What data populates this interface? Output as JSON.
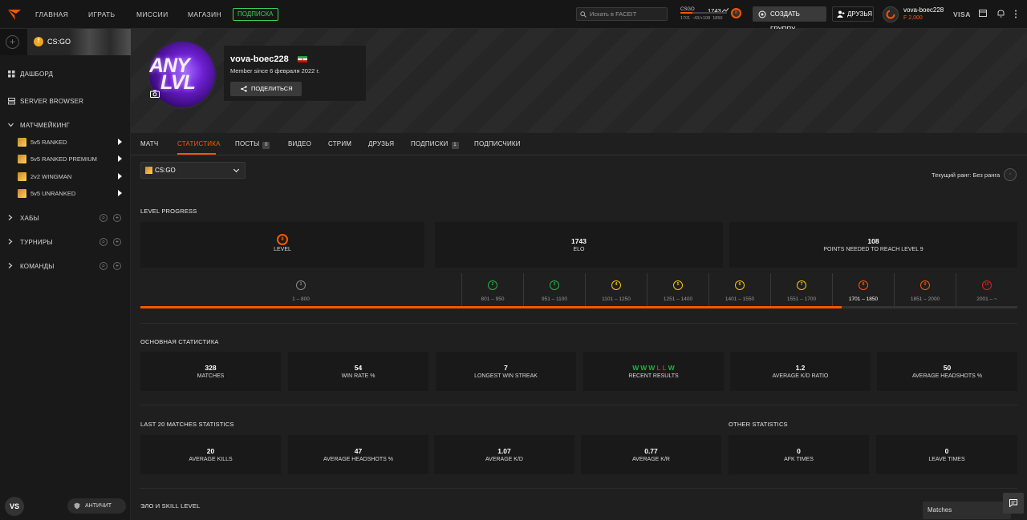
{
  "topbar": {
    "nav": [
      "ГЛАВНАЯ",
      "ИГРАТЬ",
      "МИССИИ",
      "МАГАЗИН"
    ],
    "subscribe_label": "ПОДПИСКА",
    "search_placeholder": "Искать в FACEIT",
    "elo_game": "CSGO",
    "elo_value": "1743",
    "elo_detail": "1701  -43/+108  1850",
    "elo_level": "8",
    "create_group_label": "СОЗДАТЬ ГРУППУ",
    "friends_label": "ДРУЗЬЯ",
    "user_name": "vova-boec228",
    "user_points": "2,000",
    "visa_label": "VISA"
  },
  "sidebar": {
    "game_label": "CS:GO",
    "dashboard": "ДАШБОРД",
    "server_browser": "SERVER BROWSER",
    "matchmaking": "МАТЧМЕЙКИНГ",
    "queues": [
      "5v5 RANKED",
      "5v5 RANKED PREMIUM",
      "2v2 WINGMAN",
      "5v5 UNRANKED"
    ],
    "hubs": "ХАБЫ",
    "tournaments": "ТУРНИРЫ",
    "teams": "КОМАНДЫ",
    "vs_label": "VS",
    "anticheat_label": "АНТИЧИТ"
  },
  "profile": {
    "avatar_text_line1": "ANY",
    "avatar_text_line2": "LVL",
    "username": "vova-boec228",
    "member_since": "Member since 6 февраля 2022 г.",
    "share_label": "ПОДЕЛИТЬСЯ"
  },
  "tabs": [
    {
      "label": "МАТЧ",
      "badge": ""
    },
    {
      "label": "СТАТИСТИКА",
      "badge": ""
    },
    {
      "label": "ПОСТЫ",
      "badge": "0"
    },
    {
      "label": "ВИДЕО",
      "badge": ""
    },
    {
      "label": "СТРИМ",
      "badge": ""
    },
    {
      "label": "ДРУЗЬЯ",
      "badge": ""
    },
    {
      "label": "ПОДПИСКИ",
      "badge": "1"
    },
    {
      "label": "ПОДПИСЧИКИ",
      "badge": ""
    }
  ],
  "main": {
    "game_select": "CS:GO",
    "current_rank": "Текущий ранг: Без ранга",
    "level_progress_title": "LEVEL PROGRESS",
    "level_card": {
      "value": "8",
      "label": "LEVEL"
    },
    "elo_card": {
      "value": "1743",
      "label": "ELO"
    },
    "points_card": {
      "value": "108",
      "label": "POINTS NEEDED TO REACH LEVEL 9"
    },
    "level_ranges": [
      {
        "level": "1",
        "range": "1 – 800",
        "color": "#8a8a8a"
      },
      {
        "level": "2",
        "range": "801 – 950",
        "color": "#1fb33f"
      },
      {
        "level": "3",
        "range": "951 – 1100",
        "color": "#1fb33f"
      },
      {
        "level": "4",
        "range": "1101 – 1250",
        "color": "#f5c800"
      },
      {
        "level": "5",
        "range": "1251 – 1400",
        "color": "#f5c800"
      },
      {
        "level": "6",
        "range": "1401 – 1550",
        "color": "#f5c800"
      },
      {
        "level": "7",
        "range": "1551 – 1700",
        "color": "#f5c800"
      },
      {
        "level": "8",
        "range": "1701 – 1850",
        "color": "#ff5500"
      },
      {
        "level": "9",
        "range": "1851 – 2000",
        "color": "#ff5500"
      },
      {
        "level": "10",
        "range": "2001 – ~",
        "color": "#e01d1d"
      }
    ],
    "progress_fraction": 0.8,
    "main_stats_title": "ОСНОВНАЯ СТАТИСТИКА",
    "main_stats": [
      {
        "value": "328",
        "label": "MATCHES"
      },
      {
        "value": "54",
        "label": "WIN RATE %"
      },
      {
        "value": "7",
        "label": "LONGEST WIN STREAK"
      },
      {
        "value": "",
        "label": "RECENT RESULTS"
      },
      {
        "value": "1.2",
        "label": "AVERAGE K/D RATIO"
      },
      {
        "value": "50",
        "label": "AVERAGE HEADSHOTS %"
      }
    ],
    "recent_results": [
      {
        "r": "W",
        "color": "#1fb33f"
      },
      {
        "r": "W",
        "color": "#1fb33f"
      },
      {
        "r": "W",
        "color": "#1fb33f"
      },
      {
        "r": "L",
        "color": "#e01d1d"
      },
      {
        "r": "L",
        "color": "#e01d1d"
      },
      {
        "r": "W",
        "color": "#1fb33f"
      }
    ],
    "last20_title": "LAST 20 MATCHES STATISTICS",
    "other_title": "OTHER STATISTICS",
    "last20_stats": [
      {
        "value": "20",
        "label": "AVERAGE KILLS"
      },
      {
        "value": "47",
        "label": "AVERAGE HEADSHOTS %"
      },
      {
        "value": "1.07",
        "label": "AVERAGE K/D"
      },
      {
        "value": "0.77",
        "label": "AVERAGE K/R"
      }
    ],
    "other_stats": [
      {
        "value": "0",
        "label": "AFK TIMES"
      },
      {
        "value": "0",
        "label": "LEAVE TIMES"
      }
    ],
    "elo_skill_title": "ЭЛО И SKILL LEVEL",
    "dropdown_value": "Matches"
  },
  "colors": {
    "accent": "#ff5500",
    "green": "#32d35a"
  }
}
